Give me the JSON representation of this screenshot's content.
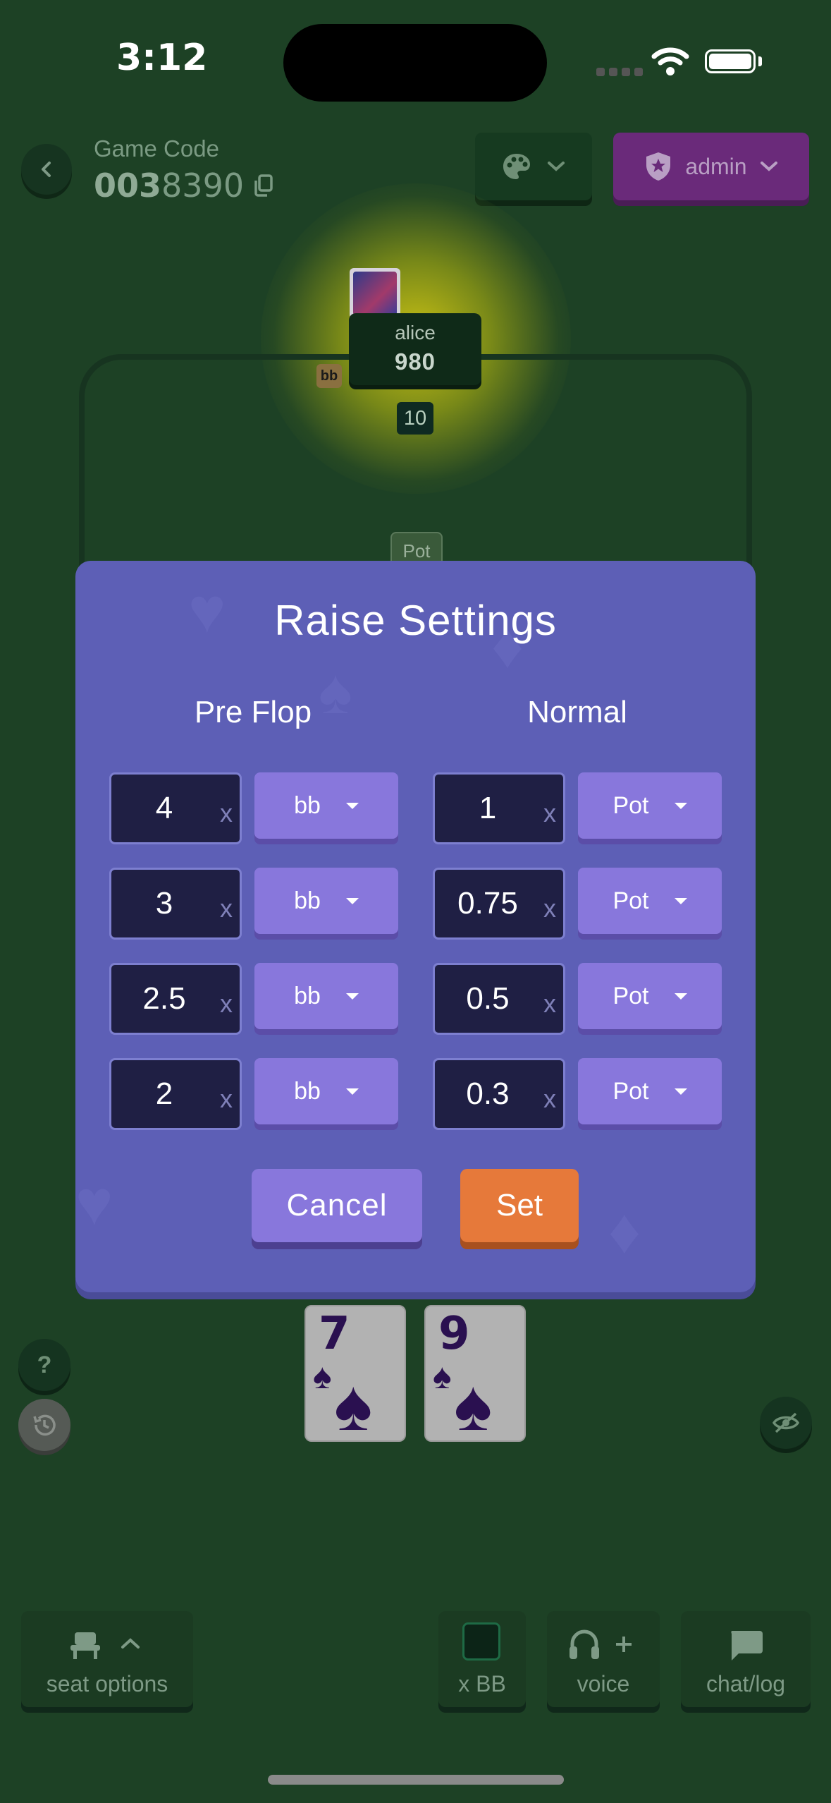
{
  "status_bar": {
    "time": "3:12"
  },
  "header": {
    "game_code_label": "Game Code",
    "game_code_prefix": "003",
    "game_code_suffix": "8390",
    "admin_label": "admin"
  },
  "table": {
    "player_name": "alice",
    "player_stack": "980",
    "blind_badge": "bb",
    "bet_amount": "10",
    "pot_label": "Pot"
  },
  "modal": {
    "title": "Raise Settings",
    "preflop_title": "Pre Flop",
    "normal_title": "Normal",
    "multiplier_suffix": "x",
    "preflop_rows": [
      {
        "value": "4",
        "unit": "bb"
      },
      {
        "value": "3",
        "unit": "bb"
      },
      {
        "value": "2.5",
        "unit": "bb"
      },
      {
        "value": "2",
        "unit": "bb"
      }
    ],
    "normal_rows": [
      {
        "value": "1",
        "unit": "Pot"
      },
      {
        "value": "0.75",
        "unit": "Pot"
      },
      {
        "value": "0.5",
        "unit": "Pot"
      },
      {
        "value": "0.3",
        "unit": "Pot"
      }
    ],
    "cancel_label": "Cancel",
    "set_label": "Set"
  },
  "hand": [
    {
      "rank": "7",
      "suit": "♠"
    },
    {
      "rank": "9",
      "suit": "♠"
    }
  ],
  "side": {
    "help_label": "?"
  },
  "bottom_bar": {
    "seat_options": "seat options",
    "xbb": "x BB",
    "voice": "voice",
    "chat": "chat/log"
  },
  "colors": {
    "background": "#1d4125",
    "modal": "#5d5fb6",
    "unit_button": "#8877dc",
    "set_button": "#e6793a",
    "admin_button": "#6a2a7a"
  },
  "icons": [
    "chevron-left-icon",
    "copy-icon",
    "palette-icon",
    "chevron-down-icon",
    "shield-star-icon",
    "spade-icon",
    "help-icon",
    "history-icon",
    "eye-off-icon",
    "seat-icon",
    "chevron-up-icon",
    "headset-icon",
    "plus-icon",
    "chat-icon"
  ]
}
